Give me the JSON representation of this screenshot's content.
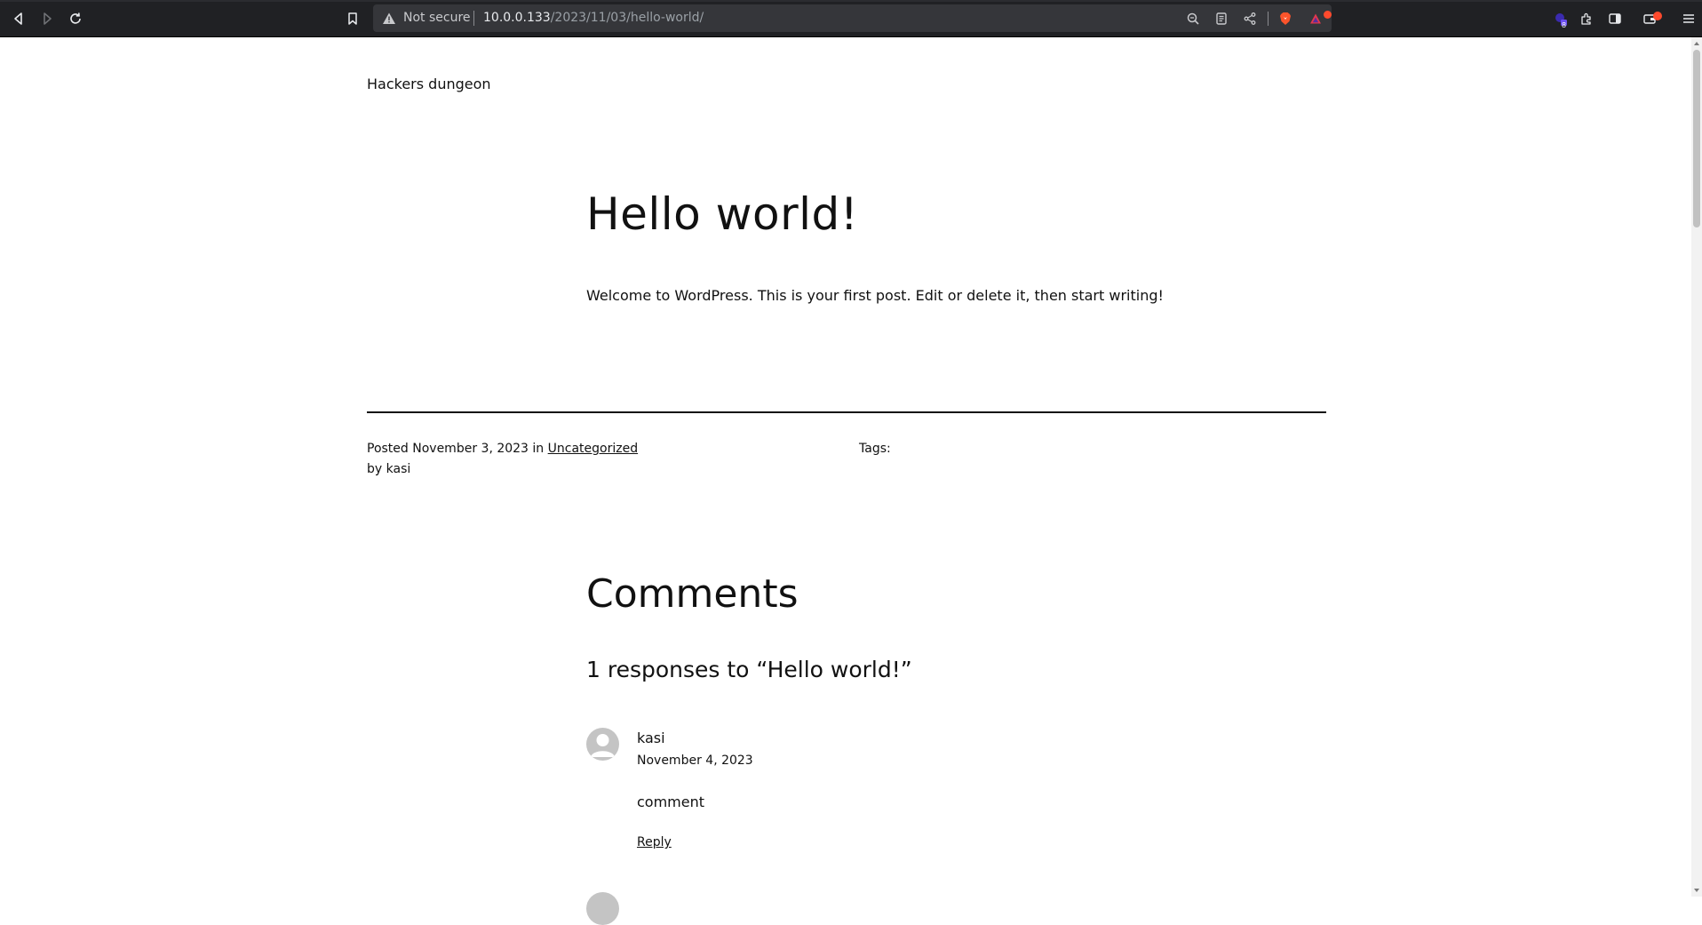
{
  "browser": {
    "security_label": "Not secure",
    "url_host": "10.0.0.133",
    "url_path": "/2023/11/03/hello-world/",
    "extension_badge_count": "8",
    "icons": [
      "back-icon",
      "forward-icon",
      "reload-icon",
      "bookmark-icon",
      "warning-icon",
      "zoom-icon",
      "reader-mode-icon",
      "share-icon",
      "brave-shields-icon",
      "brave-rewards-icon",
      "extension-badge-icon",
      "extensions-icon",
      "sidebar-icon",
      "wallet-icon",
      "menu-icon"
    ],
    "colors": {
      "toolbar": "#202124",
      "urlbar": "#35363a",
      "brave_orange": "#fb542b",
      "notification": "#ff4a2d"
    }
  },
  "site": {
    "title": "Hackers dungeon"
  },
  "post": {
    "title": "Hello world!",
    "content": "Welcome to WordPress. This is your first post. Edit or delete it, then start writing!",
    "meta": {
      "posted_label": "Posted",
      "date": "November 3, 2023",
      "in_label": "in",
      "category": "Uncategorized",
      "by_label": "by",
      "author": "kasi",
      "tags_label": "Tags:"
    }
  },
  "comments": {
    "heading": "Comments",
    "count_text": "1 responses to “Hello world!”",
    "items": [
      {
        "author": "kasi",
        "date": "November 4, 2023",
        "text": "comment",
        "reply_label": "Reply"
      }
    ]
  }
}
